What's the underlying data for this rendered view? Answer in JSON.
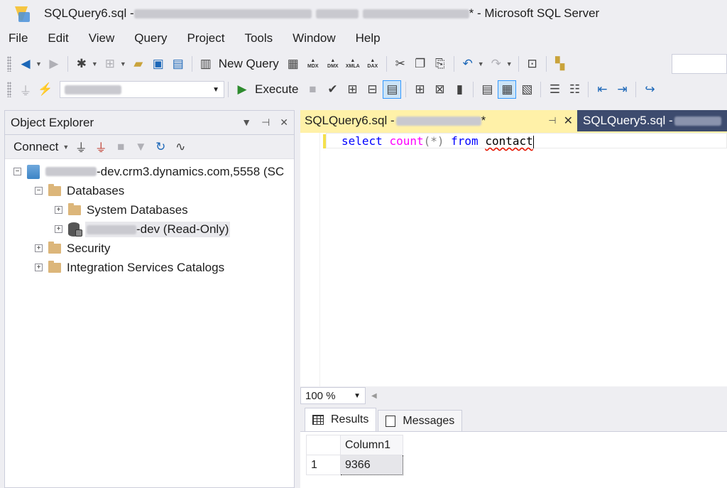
{
  "window": {
    "title_prefix": "SQLQuery6.sql - ",
    "title_suffix": "* - Microsoft SQL Server"
  },
  "menu": [
    "File",
    "Edit",
    "View",
    "Query",
    "Project",
    "Tools",
    "Window",
    "Help"
  ],
  "toolbar": {
    "new_query_label": "New Query",
    "execute_label": "Execute",
    "mdx_label": "MDX",
    "dmx_label": "DMX",
    "xmla_label": "XMLA",
    "dax_label": "DAX"
  },
  "object_explorer": {
    "title": "Object Explorer",
    "connect_label": "Connect",
    "server_suffix": "-dev.crm3.dynamics.com,5558 (SC",
    "databases_label": "Databases",
    "system_databases_label": "System Databases",
    "db_suffix": "-dev (Read-Only)",
    "security_label": "Security",
    "integration_label": "Integration Services Catalogs"
  },
  "editor": {
    "active_tab_prefix": "SQLQuery6.sql - ",
    "active_tab_suffix": "*",
    "inactive_tab_prefix": "SQLQuery5.sql - ",
    "code": {
      "kw_select": "select",
      "fn_count": "count",
      "args": "(*)",
      "kw_from": "from",
      "table": "contact"
    }
  },
  "zoom": "100 %",
  "results": {
    "tab_results": "Results",
    "tab_messages": "Messages",
    "column_header": "Column1",
    "rows": [
      {
        "num": "1",
        "value": "9366"
      }
    ]
  }
}
